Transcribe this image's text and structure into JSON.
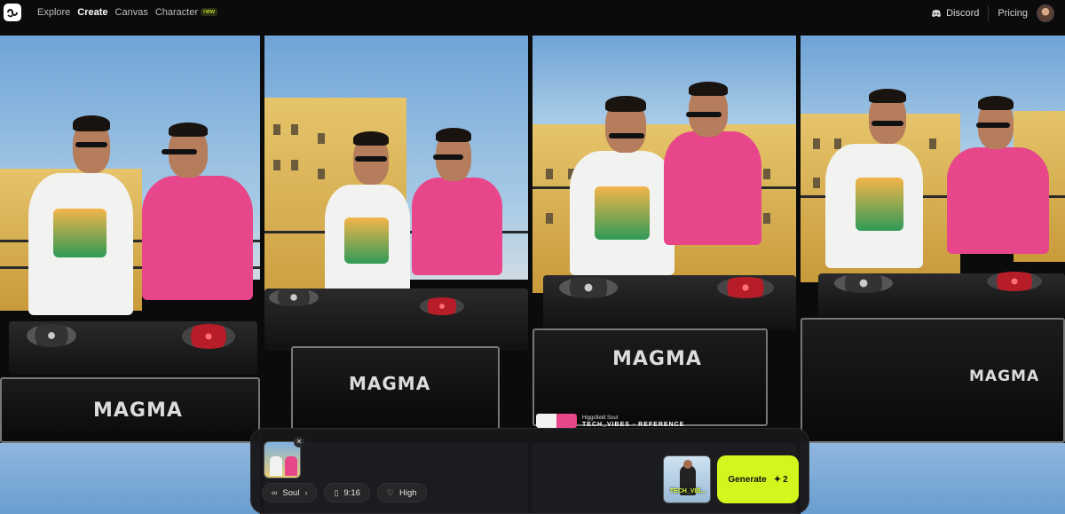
{
  "nav": {
    "items": [
      {
        "label": "Explore",
        "active": false
      },
      {
        "label": "Create",
        "active": true
      },
      {
        "label": "Canvas",
        "active": false
      },
      {
        "label": "Character",
        "active": false,
        "badge": "new"
      }
    ],
    "discord_label": "Discord",
    "pricing_label": "Pricing"
  },
  "gallery": {
    "images": [
      {
        "case_label": "MAGMA"
      },
      {
        "case_label": "MAGMA"
      },
      {
        "case_label": "MAGMA"
      },
      {
        "case_label": "MAGMA"
      }
    ],
    "overlay": {
      "source": "Higgsfield Soul",
      "title": "TECH_VIBES - REFERENCE"
    }
  },
  "composer": {
    "chips": [
      {
        "icon": "soul-icon",
        "label": "Soul"
      },
      {
        "icon": "aspect-ratio-icon",
        "label": "9:16"
      },
      {
        "icon": "quality-icon",
        "label": "High"
      }
    ],
    "style_label": "TECH_VIB...",
    "generate_label": "Generate",
    "generate_cost": "2"
  },
  "colors": {
    "accent": "#d4f51e",
    "background": "#0b0b0b",
    "new_badge": "#d7ff2e"
  }
}
